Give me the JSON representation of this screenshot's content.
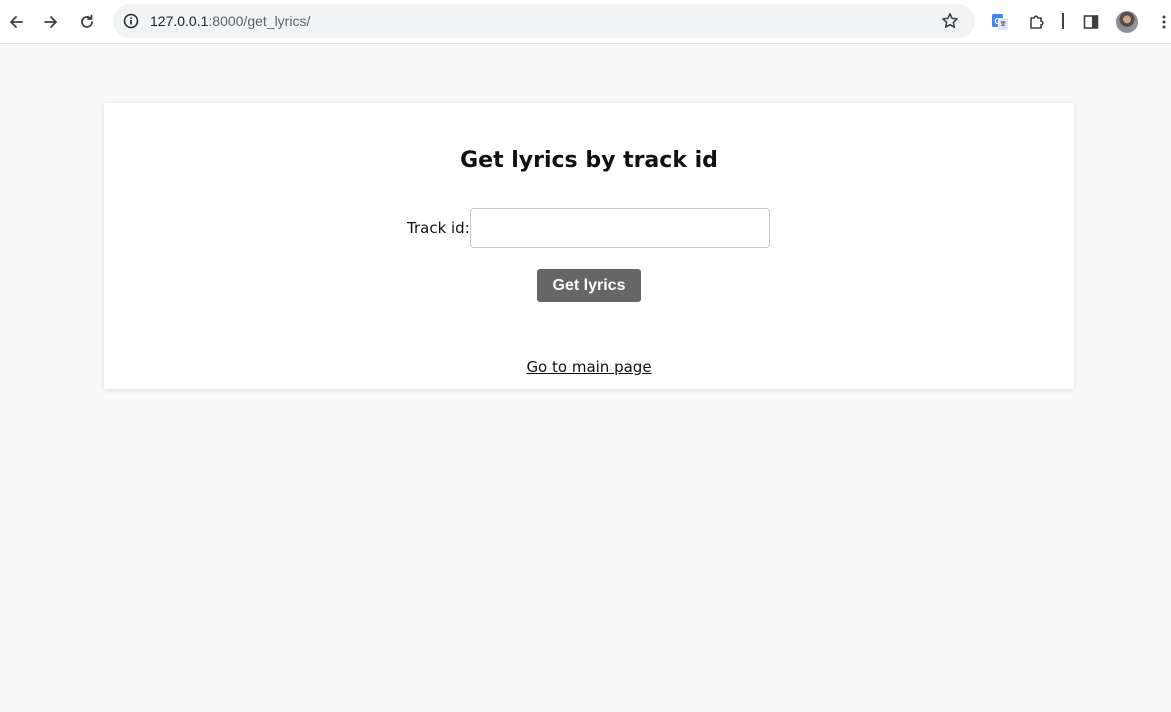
{
  "browser": {
    "url_host": "127.0.0.1",
    "url_path": ":8000/get_lyrics/",
    "icons": {
      "back": "arrow-left-icon",
      "forward": "arrow-right-icon",
      "reload": "reload-icon",
      "site_info": "info-circle-icon",
      "bookmark": "star-icon",
      "translate": "google-translate-icon",
      "extensions": "puzzle-icon",
      "side_panel": "side-panel-icon",
      "profile": "avatar",
      "menu": "kebab-menu-icon"
    }
  },
  "page": {
    "heading": "Get lyrics by track id",
    "track_label": "Track id:",
    "track_input_value": "",
    "submit_label": "Get lyrics",
    "main_link_label": "Go to main page",
    "colors": {
      "background": "#f9f9f9",
      "card": "#ffffff",
      "button": "#666666",
      "button_text": "#ffffff"
    }
  }
}
